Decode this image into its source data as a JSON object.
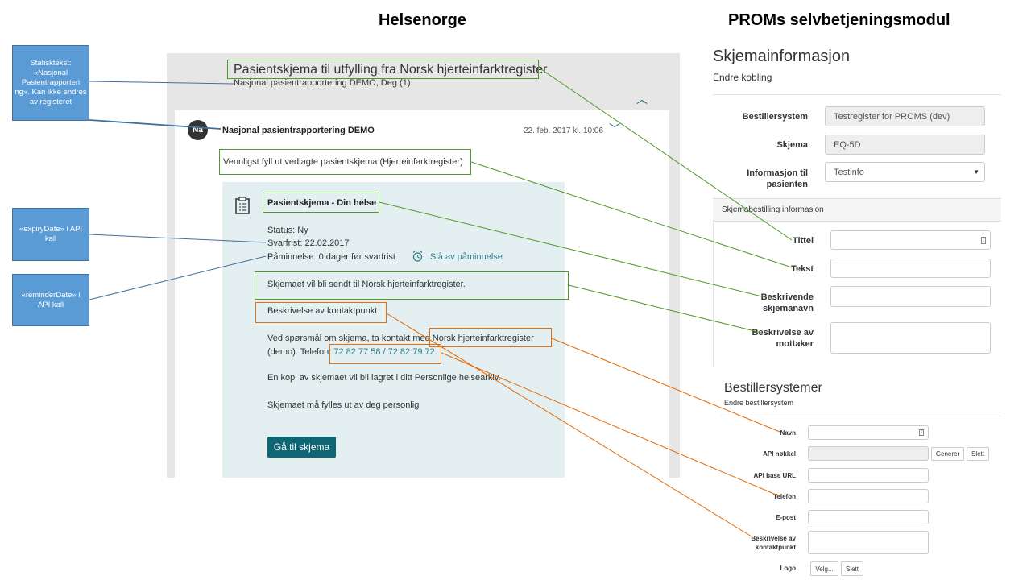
{
  "headings": {
    "left": "Helsenorge",
    "right": "PROMs selvbetjeningsmodul"
  },
  "notes": [
    "Statisktekst: «Nasjonal Pasientrapporteri ng». Kan ikke endres av registeret",
    "«expiryDate» i API kall",
    "«reminderDate» i API kall"
  ],
  "helsenorge": {
    "title": "Pasientskjema til utfylling fra Norsk hjerteinfarktregister",
    "subtitle": "Nasjonal pasientrapportering DEMO, Deg (1)",
    "avatar": "Na",
    "sender": "Nasjonal pasientrapportering DEMO",
    "date": "22. feb. 2017 kl. 10:06",
    "message": "Vennligst fyll ut vedlagte pasientskjema (Hjerteinfarktregister)",
    "form_title": "Pasientskjema - Din helse",
    "status": "Status: Ny",
    "deadline": "Svarfrist: 22.02.2017",
    "reminder": "Påminnelse: 0 dager før svarfrist",
    "reminder_off": "Slå av påminnelse",
    "send_info": "Skjemaet vil bli sendt til Norsk hjerteinfarktregister.",
    "contact_heading": "Beskrivelse av kontaktpunkt",
    "contact_line1": "Ved spørsmål om skjema, ta kontakt med Norsk hjerteinfarktregister",
    "contact_line2_prefix": "(demo). Telefon:",
    "phone": "72 82 77 58 / 72 82 79 72.",
    "copy_info": "En kopi av skjemaet vil bli lagret i ditt Personlige helsearkiv.",
    "personal": "Skjemaet må fylles ut av deg personlig",
    "button": "Gå til skjema"
  },
  "proms": {
    "title": "Skjemainformasjon",
    "subtitle": "Endre kobling",
    "fields": {
      "bestillersystem_label": "Bestillersystem",
      "bestillersystem_value": "Testregister for PROMS (dev)",
      "skjema_label": "Skjema",
      "skjema_value": "EQ-5D",
      "info_label_1": "Informasjon til",
      "info_label_2": "pasienten",
      "info_value": "Testinfo"
    },
    "section": "Skjemabestilling informasjon",
    "order": {
      "tittel": "Tittel",
      "tekst": "Tekst",
      "beskr_navn_1": "Beskrivende",
      "beskr_navn_2": "skjemanavn",
      "beskr_mott_1": "Beskrivelse av",
      "beskr_mott_2": "mottaker"
    },
    "systems_title": "Bestillersystemer",
    "systems_subtitle": "Endre bestillersystem",
    "systems": {
      "navn": "Navn",
      "api_key": "API nøkkel",
      "generer": "Generer",
      "slett": "Slett",
      "api_url": "API base URL",
      "telefon": "Telefon",
      "epost": "E-post",
      "beskr_1": "Beskrivelse av",
      "beskr_2": "kontaktpunkt",
      "logo": "Logo",
      "velg": "Velg..."
    }
  },
  "colors": {
    "green": "#4f9a2c",
    "orange": "#e46c0a",
    "blue_note": "#5b9bd5",
    "teal": "#0e6573"
  }
}
